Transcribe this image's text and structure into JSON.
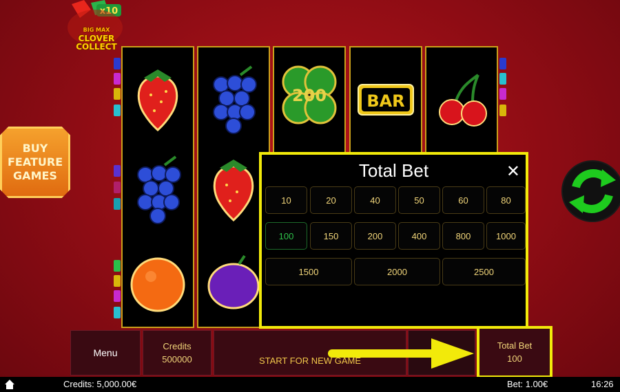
{
  "game": {
    "logo_text": "BIG MAX\nCLOVER\nCOLLECT",
    "logo_multiplier": "x10",
    "logo_icon": "big-max-clover-collect-logo"
  },
  "buy_feature": {
    "label": "BUY FEATURE GAMES"
  },
  "reels": [
    [
      "strawberry",
      "grapes",
      "orange"
    ],
    [
      "grapes",
      "strawberry",
      "plum"
    ],
    [
      "clover-200",
      "",
      ""
    ],
    [
      "bar",
      "",
      ""
    ],
    [
      "cherries",
      "",
      ""
    ]
  ],
  "symbol_texts": {
    "clover": "200",
    "bar": "BAR"
  },
  "total_bet_panel": {
    "title": "Total Bet",
    "close_icon": "close-icon",
    "options_row1": [
      "10",
      "20",
      "40",
      "50",
      "60",
      "80"
    ],
    "options_row2": [
      "100",
      "150",
      "200",
      "400",
      "800",
      "1000"
    ],
    "options_row3": [
      "1500",
      "2000",
      "2500"
    ],
    "selected": "100"
  },
  "bottom": {
    "menu_label": "Menu",
    "credits_label": "Credits",
    "credits_value": "500000",
    "start_label": "START FOR NEW GAME",
    "total_bet_label": "Total Bet",
    "total_bet_value": "100"
  },
  "status_bar": {
    "home_icon": "home-icon",
    "credits": "Credits: 5,000.00€",
    "bet": "Bet: 1.00€",
    "time": "16:26"
  },
  "colors": {
    "highlight": "#f2ea0a",
    "selected_option": "#2ec24a",
    "option_text": "#f2d67a",
    "reel_border": "#caa11a",
    "spin_green": "#1ecb1e"
  }
}
